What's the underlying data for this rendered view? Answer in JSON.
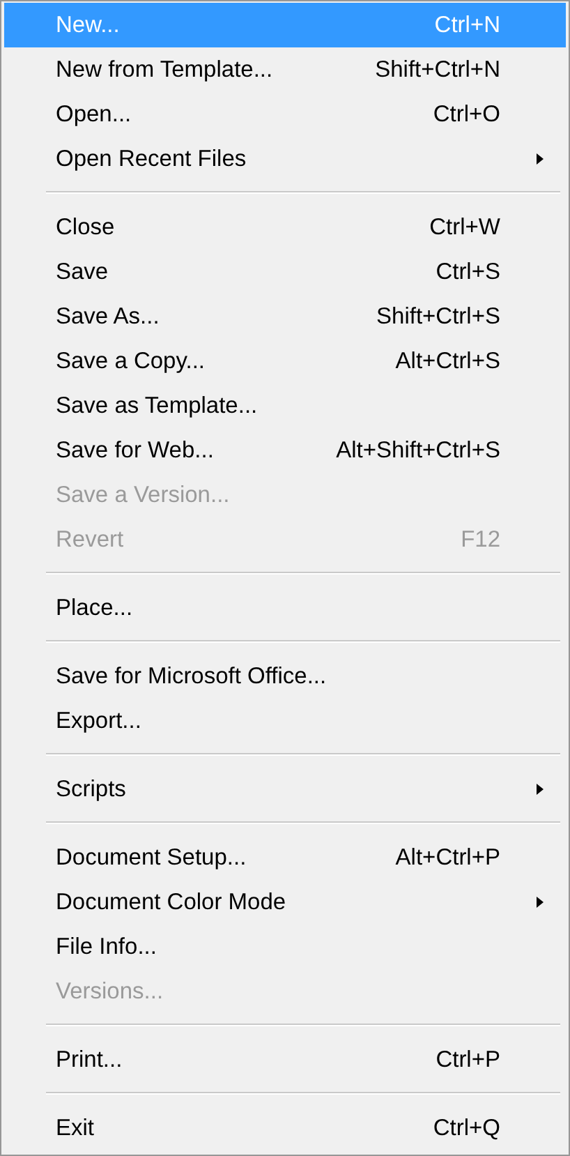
{
  "menu": {
    "items": [
      {
        "kind": "item",
        "label": "New...",
        "shortcut": "Ctrl+N",
        "selected": true,
        "disabled": false,
        "submenu": false
      },
      {
        "kind": "item",
        "label": "New from Template...",
        "shortcut": "Shift+Ctrl+N",
        "selected": false,
        "disabled": false,
        "submenu": false
      },
      {
        "kind": "item",
        "label": "Open...",
        "shortcut": "Ctrl+O",
        "selected": false,
        "disabled": false,
        "submenu": false
      },
      {
        "kind": "item",
        "label": "Open Recent Files",
        "selected": false,
        "disabled": false,
        "submenu": true
      },
      {
        "kind": "separator"
      },
      {
        "kind": "item",
        "label": "Close",
        "shortcut": "Ctrl+W",
        "selected": false,
        "disabled": false,
        "submenu": false
      },
      {
        "kind": "item",
        "label": "Save",
        "shortcut": "Ctrl+S",
        "selected": false,
        "disabled": false,
        "submenu": false
      },
      {
        "kind": "item",
        "label": "Save As...",
        "shortcut": "Shift+Ctrl+S",
        "selected": false,
        "disabled": false,
        "submenu": false
      },
      {
        "kind": "item",
        "label": "Save a Copy...",
        "shortcut": "Alt+Ctrl+S",
        "selected": false,
        "disabled": false,
        "submenu": false
      },
      {
        "kind": "item",
        "label": "Save as Template...",
        "selected": false,
        "disabled": false,
        "submenu": false
      },
      {
        "kind": "item",
        "label": "Save for Web...",
        "shortcut": "Alt+Shift+Ctrl+S",
        "selected": false,
        "disabled": false,
        "submenu": false
      },
      {
        "kind": "item",
        "label": "Save a Version...",
        "selected": false,
        "disabled": true,
        "submenu": false
      },
      {
        "kind": "item",
        "label": "Revert",
        "shortcut": "F12",
        "selected": false,
        "disabled": true,
        "submenu": false
      },
      {
        "kind": "separator"
      },
      {
        "kind": "item",
        "label": "Place...",
        "selected": false,
        "disabled": false,
        "submenu": false
      },
      {
        "kind": "separator"
      },
      {
        "kind": "item",
        "label": "Save for Microsoft Office...",
        "selected": false,
        "disabled": false,
        "submenu": false
      },
      {
        "kind": "item",
        "label": "Export...",
        "selected": false,
        "disabled": false,
        "submenu": false
      },
      {
        "kind": "separator"
      },
      {
        "kind": "item",
        "label": "Scripts",
        "selected": false,
        "disabled": false,
        "submenu": true
      },
      {
        "kind": "separator"
      },
      {
        "kind": "item",
        "label": "Document Setup...",
        "shortcut": "Alt+Ctrl+P",
        "selected": false,
        "disabled": false,
        "submenu": false
      },
      {
        "kind": "item",
        "label": "Document Color Mode",
        "selected": false,
        "disabled": false,
        "submenu": true
      },
      {
        "kind": "item",
        "label": "File Info...",
        "selected": false,
        "disabled": false,
        "submenu": false
      },
      {
        "kind": "item",
        "label": "Versions...",
        "selected": false,
        "disabled": true,
        "submenu": false
      },
      {
        "kind": "separator"
      },
      {
        "kind": "item",
        "label": "Print...",
        "shortcut": "Ctrl+P",
        "selected": false,
        "disabled": false,
        "submenu": false
      },
      {
        "kind": "separator"
      },
      {
        "kind": "item",
        "label": "Exit",
        "shortcut": "Ctrl+Q",
        "selected": false,
        "disabled": false,
        "submenu": false
      }
    ]
  }
}
